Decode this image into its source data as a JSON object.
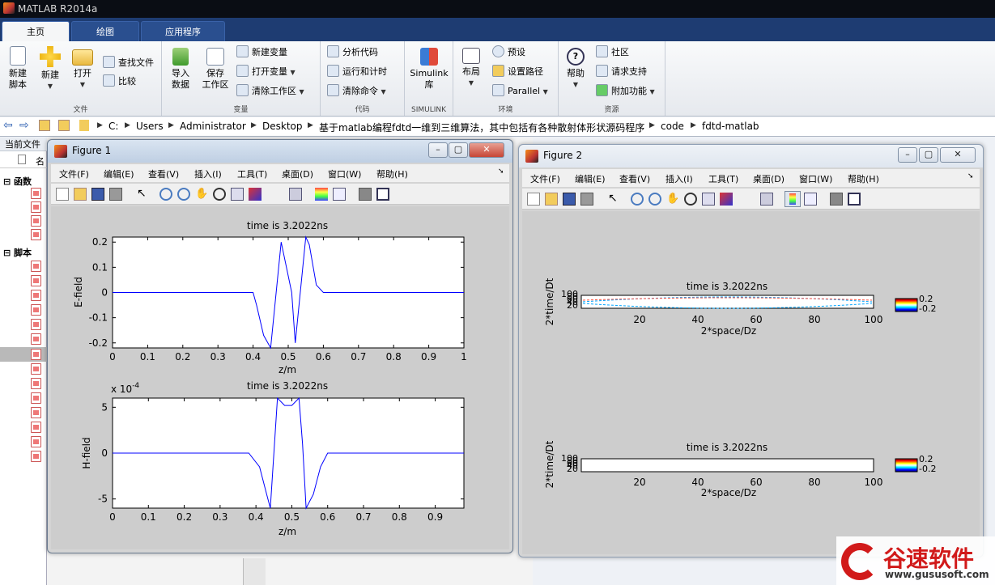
{
  "app": {
    "title": "MATLAB R2014a"
  },
  "ribbon_tabs": [
    {
      "label": "主页"
    },
    {
      "label": "绘图"
    },
    {
      "label": "应用程序"
    }
  ],
  "ribbon": {
    "file": {
      "name": "文件",
      "new_script": "新建\n脚本",
      "new": "新建",
      "open": "打开",
      "find_files": "查找文件",
      "compare": "比较"
    },
    "variable": {
      "name": "变量",
      "import": "导入\n数据",
      "save": "保存\n工作区",
      "new_var": "新建变量",
      "open_var": "打开变量",
      "clear_ws": "清除工作区"
    },
    "code": {
      "name": "代码",
      "analyze": "分析代码",
      "run_time": "运行和计时",
      "clear_cmd": "清除命令"
    },
    "simulink": {
      "name": "SIMULINK",
      "lib": "Simulink\n库"
    },
    "env": {
      "name": "环境",
      "layout": "布局",
      "prefs": "预设",
      "set_path": "设置路径",
      "parallel": "Parallel"
    },
    "resources": {
      "name": "资源",
      "help": "帮助",
      "community": "社区",
      "support": "请求支持",
      "addons": "附加功能"
    }
  },
  "address": {
    "crumbs": [
      "C:",
      "Users",
      "Administrator",
      "Desktop",
      "基于matlab编程fdtd一维到三维算法，其中包括有各种散射体形状源码程序",
      "code",
      "fdtd-matlab"
    ]
  },
  "left_panel": {
    "title": "当前文件",
    "col_name": "名",
    "section_functions": "函数",
    "section_scripts": "脚本"
  },
  "figure_menu": [
    "文件(F)",
    "编辑(E)",
    "查看(V)",
    "插入(I)",
    "工具(T)",
    "桌面(D)",
    "窗口(W)",
    "帮助(H)"
  ],
  "figure1": {
    "title": "Figure 1",
    "plot1": {
      "title": "time is 3.2022ns",
      "ylabel": "E-field",
      "xlabel": "z/m",
      "yticks": [
        "0.2",
        "0.1",
        "0",
        "-0.1",
        "-0.2"
      ],
      "xticks": [
        "0",
        "0.1",
        "0.2",
        "0.3",
        "0.4",
        "0.5",
        "0.6",
        "0.7",
        "0.8",
        "0.9",
        "1"
      ]
    },
    "plot2": {
      "title": "time is 3.2022ns",
      "ylabel": "H-field",
      "xlabel": "z/m",
      "exponent": "x 10",
      "exponent_power": "-4",
      "yticks": [
        "5",
        "0",
        "-5"
      ],
      "xticks": [
        "0",
        "0.1",
        "0.2",
        "0.3",
        "0.4",
        "0.5",
        "0.6",
        "0.7",
        "0.8",
        "0.9"
      ]
    }
  },
  "figure2": {
    "title": "Figure 2",
    "plot1": {
      "title": "time is 3.2022ns",
      "ylabel": "2*time/Dt",
      "xlabel": "2*space/Dz",
      "xticks": [
        "20",
        "40",
        "60",
        "80",
        "100"
      ],
      "yticks": [
        "100",
        "80",
        "60",
        "40",
        "20"
      ],
      "cbar": [
        "0.2",
        "-0.2"
      ]
    },
    "plot2": {
      "title": "time is 3.2022ns",
      "ylabel": "2*time/Dt",
      "xlabel": "2*space/Dz",
      "xticks": [
        "20",
        "40",
        "60",
        "80",
        "100"
      ],
      "yticks": [
        "100",
        "80",
        "60",
        "40",
        "20"
      ],
      "cbar": [
        "0.2",
        "-0.2"
      ]
    }
  },
  "watermark": {
    "brand": "谷速软件",
    "url": "www.gususoft.com"
  },
  "chart_data": [
    {
      "type": "line",
      "title": "time is 3.2022ns",
      "xlabel": "z/m",
      "ylabel": "E-field",
      "xlim": [
        0,
        1
      ],
      "ylim": [
        -0.22,
        0.22
      ],
      "x": [
        0,
        0.4,
        0.41,
        0.43,
        0.45,
        0.48,
        0.51,
        0.52,
        0.55,
        0.56,
        0.58,
        0.6,
        1
      ],
      "y": [
        0,
        0,
        -0.05,
        -0.17,
        -0.22,
        0.2,
        0.0,
        -0.2,
        0.22,
        0.19,
        0.03,
        0,
        0
      ]
    },
    {
      "type": "line",
      "title": "time is 3.2022ns",
      "xlabel": "z/m",
      "ylabel": "H-field",
      "ylim": [
        -0.0006,
        0.0006
      ],
      "xlim": [
        0,
        0.98
      ],
      "x": [
        0,
        0.38,
        0.41,
        0.43,
        0.44,
        0.46,
        0.48,
        0.5,
        0.52,
        0.53,
        0.54,
        0.56,
        0.58,
        0.6,
        0.98
      ],
      "y": [
        0,
        0,
        -0.00015,
        -0.00045,
        -0.0006,
        0.0006,
        0.00052,
        0.00052,
        0.0006,
        0.0001,
        -0.0006,
        -0.00045,
        -0.00015,
        0,
        0
      ]
    }
  ],
  "colors": {
    "line": "#0000ff",
    "ribbon_tab_active": "#f5f6f7",
    "ribbon_tabbar": "#1e3c72",
    "watermark_red": "#d11a1a"
  }
}
